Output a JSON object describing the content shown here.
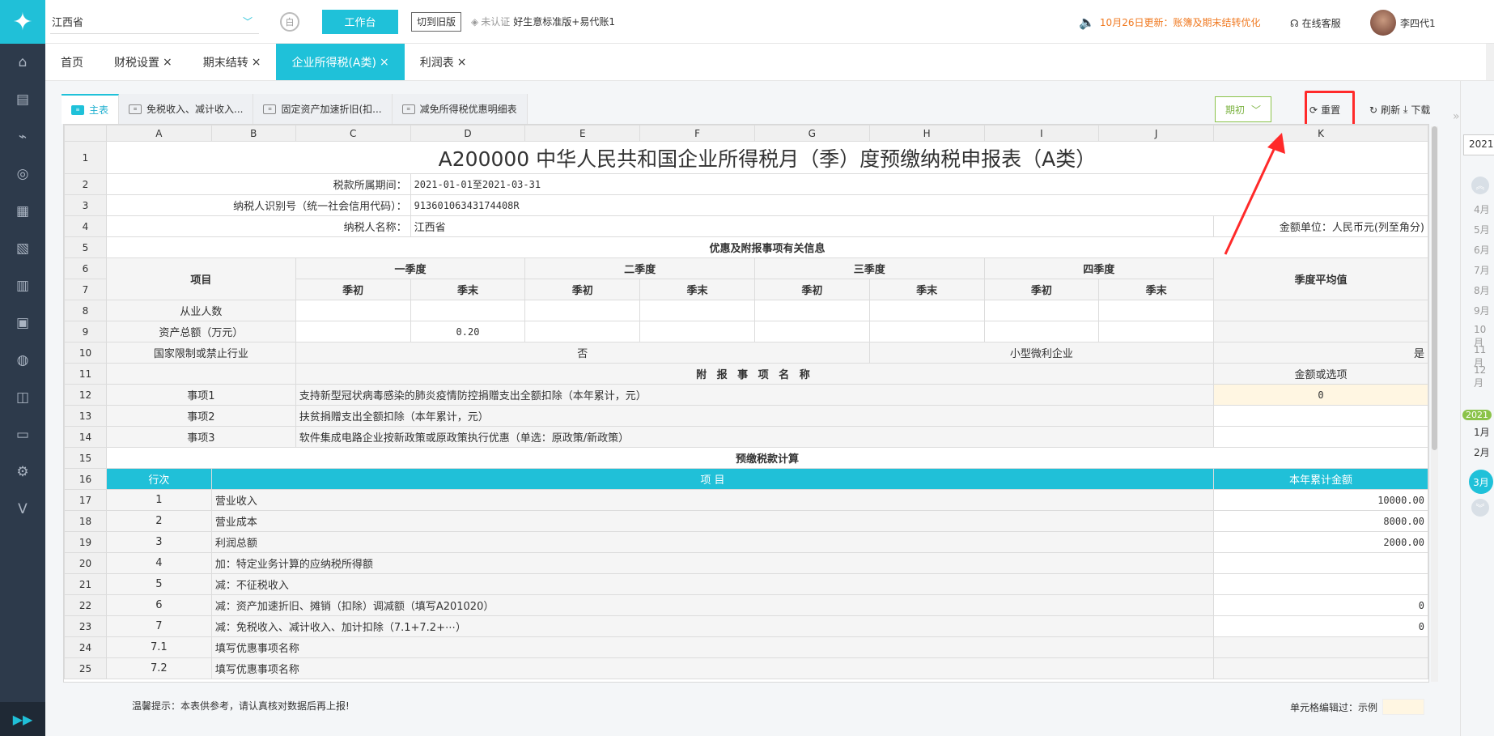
{
  "sidebar": {
    "logo": "✦",
    "icons": [
      "home-icon",
      "voucher-icon",
      "chart-icon",
      "money-bag-icon",
      "ledger-icon",
      "report-icon",
      "store-icon",
      "invoice-icon",
      "hand-coin-icon",
      "tax-icon",
      "inbox-icon",
      "gear-icon",
      "v-icon"
    ],
    "icon_glyphs": [
      "⌂",
      "▤",
      "⌁",
      "◎",
      "▦",
      "▧",
      "▥",
      "▣",
      "◍",
      "◫",
      "▭",
      "⚙",
      "V"
    ],
    "toggle": "▶▶"
  },
  "topbar": {
    "company": "江西省",
    "workbench": "工作台",
    "switch_old": "切到旧版",
    "cert": "未认证",
    "product": "好生意标准版+易代账1",
    "notice": "10月26日更新：账簿及期末结转优化",
    "service": "在线客服",
    "user": "李四代1"
  },
  "navtabs": [
    {
      "label": "首页",
      "closable": false,
      "active": false
    },
    {
      "label": "财税设置",
      "closable": true,
      "active": false
    },
    {
      "label": "期末结转",
      "closable": true,
      "active": false
    },
    {
      "label": "企业所得税(A类)",
      "closable": true,
      "active": true
    },
    {
      "label": "利润表",
      "closable": true,
      "active": false
    }
  ],
  "sheet_tabs": [
    {
      "label": "主表",
      "active": true
    },
    {
      "label": "免税收入、减计收入...",
      "active": false
    },
    {
      "label": "固定资产加速折旧(扣...",
      "active": false
    },
    {
      "label": "减免所得税优惠明细表",
      "active": false
    }
  ],
  "toolbar": {
    "period": "期初",
    "reset": "重置",
    "refresh": "刷新",
    "download": "下载"
  },
  "columns": [
    "A",
    "B",
    "C",
    "D",
    "E",
    "F",
    "G",
    "H",
    "I",
    "J",
    "K"
  ],
  "sheet": {
    "title": "A200000 中华人民共和国企业所得税月（季）度预缴纳税申报表（A类）",
    "period_label": "税款所属期间：",
    "period_value": "2021-01-01至2021-03-31",
    "taxid_label": "纳税人识别号（统一社会信用代码）：",
    "taxid_value": "91360106343174408R",
    "name_label": "纳税人名称：",
    "name_value": "江西省",
    "unit": "金额单位：人民币元(列至角分)",
    "section1": "优惠及附报事项有关信息",
    "item": "项目",
    "q1": "一季度",
    "q2": "二季度",
    "q3": "三季度",
    "q4": "四季度",
    "start": "季初",
    "end": "季末",
    "avg": "季度平均值",
    "employees": "从业人数",
    "assets": "资产总额（万元）",
    "assets_q1_end": "0.20",
    "restricted": "国家限制或禁止行业",
    "restricted_value": "否",
    "small": "小型微利企业",
    "small_value": "是",
    "attach_title": "附 报 事 项 名 称",
    "amount_or_option": "金额或选项",
    "items": [
      {
        "label": "事项1",
        "desc": "支持新型冠状病毒感染的肺炎疫情防控捐赠支出全额扣除（本年累计，元）",
        "value": "0"
      },
      {
        "label": "事项2",
        "desc": "扶贫捐赠支出全额扣除（本年累计，元）",
        "value": ""
      },
      {
        "label": "事项3",
        "desc": "软件集成电路企业按新政策或原政策执行优惠（单选：原政策/新政策）",
        "value": ""
      }
    ],
    "section2": "预缴税款计算",
    "col_line": "行次",
    "col_item": "项 目",
    "col_amount": "本年累计金额",
    "calc_rows": [
      {
        "row": "17",
        "line": "1",
        "item": "营业收入",
        "amount": "10000.00"
      },
      {
        "row": "18",
        "line": "2",
        "item": "营业成本",
        "amount": "8000.00"
      },
      {
        "row": "19",
        "line": "3",
        "item": "利润总额",
        "amount": "2000.00"
      },
      {
        "row": "20",
        "line": "4",
        "item": "加：特定业务计算的应纳税所得额",
        "amount": ""
      },
      {
        "row": "21",
        "line": "5",
        "item": "减：不征税收入",
        "amount": ""
      },
      {
        "row": "22",
        "line": "6",
        "item": "减：资产加速折旧、摊销（扣除）调减额（填写A201020）",
        "amount": "0"
      },
      {
        "row": "23",
        "line": "7",
        "item": "减：免税收入、减计收入、加计扣除（7.1+7.2+⋯）",
        "amount": "0"
      },
      {
        "row": "24",
        "line": "7.1",
        "item": "填写优惠事项名称",
        "amount": ""
      },
      {
        "row": "25",
        "line": "7.2",
        "item": "填写优惠事项名称",
        "amount": ""
      }
    ]
  },
  "footer": {
    "tip": "温馨提示：本表供参考，请认真核对数据后再上报!",
    "edit_label": "单元格编辑过：示例"
  },
  "datepanel": {
    "input": "2021.0",
    "months_before": [
      "4月",
      "5月",
      "6月",
      "7月",
      "8月",
      "9月",
      "10月",
      "11月",
      "12月"
    ],
    "year_badge": "2021",
    "months_after": [
      "1月",
      "2月"
    ],
    "selected": "3月"
  },
  "colors": {
    "accent": "#1fc1d9",
    "highlight": "#ff2a2a",
    "notice": "#f07a22",
    "edited": "#fff6e2"
  }
}
